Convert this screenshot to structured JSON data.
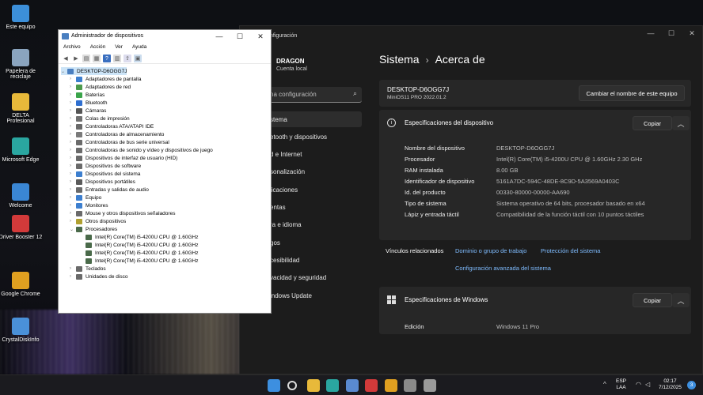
{
  "desktop": {
    "icons": [
      {
        "label": "Este equipo",
        "icon": "computer-icon",
        "color": "#3c8fd9"
      },
      {
        "label": "Papelera de reciclaje",
        "icon": "recycle-bin-icon",
        "color": "#8aa4bf"
      },
      {
        "label": "DELTA Profesional",
        "icon": "folder-icon",
        "color": "#e8b93a"
      },
      {
        "label": "Microsoft Edge",
        "icon": "edge-icon",
        "color": "#2aa6a0"
      },
      {
        "label": "Welcome",
        "icon": "welcome-icon",
        "color": "#3a86d4"
      },
      {
        "label": "Driver Booster 12",
        "icon": "driver-booster-icon",
        "color": "#d23a3a"
      },
      {
        "label": "Google Chrome",
        "icon": "chrome-icon",
        "color": "#e0a020"
      },
      {
        "label": "CrystalDiskInfo",
        "icon": "crystaldiskinfo-icon",
        "color": "#4a90d9"
      }
    ]
  },
  "settings": {
    "title": "Configuración",
    "title_visible": "nfiguración",
    "user": {
      "name": "DRAGON",
      "account": "Cuenta local"
    },
    "search": {
      "placeholder": "na configuración"
    },
    "nav": [
      {
        "label": "stema",
        "active": true
      },
      {
        "label": "etooth y dispositivos",
        "active": false
      },
      {
        "label": "d e Internet",
        "active": false
      },
      {
        "label": "sonalización",
        "active": false
      },
      {
        "label": "licaciones",
        "active": false
      },
      {
        "label": "entas",
        "active": false
      },
      {
        "label": "ra e idioma",
        "active": false
      },
      {
        "label": "gos",
        "active": false
      },
      {
        "label": "cesibilidad",
        "active": false
      },
      {
        "label": "vacidad y seguridad",
        "active": false
      },
      {
        "label": "indows Update",
        "active": false
      }
    ],
    "breadcrumb": {
      "parent": "Sistema",
      "separator": "›",
      "current": "Acerca de"
    },
    "device_card": {
      "name": "DESKTOP-D6OGG7J",
      "os": "MiniOS11 PRO 2022.01.2",
      "rename_button": "Cambiar el nombre de este equipo"
    },
    "device_specs": {
      "title": "Especificaciones del dispositivo",
      "copy_button": "Copiar",
      "rows": [
        {
          "label": "Nombre del dispositivo",
          "value": "DESKTOP-D6OGG7J"
        },
        {
          "label": "Procesador",
          "value": "Intel(R) Core(TM) i5-4200U CPU @ 1.60GHz   2.30 GHz"
        },
        {
          "label": "RAM instalada",
          "value": "8.00 GB"
        },
        {
          "label": "Identificador de dispositivo",
          "value": "5161A7DC-594C-48DE-8C9D-5A3569A0403C"
        },
        {
          "label": "Id. del producto",
          "value": "00330-80000-00000-AA690"
        },
        {
          "label": "Tipo de sistema",
          "value": "Sistema operativo de 64 bits, procesador basado en x64"
        },
        {
          "label": "Lápiz y entrada táctil",
          "value": "Compatibilidad de la función táctil con 10 puntos táctiles"
        }
      ]
    },
    "related": {
      "label": "Vínculos relacionados",
      "links": [
        "Dominio o grupo de trabajo",
        "Protección del sistema",
        "Configuración avanzada del sistema"
      ]
    },
    "windows_specs": {
      "title": "Especificaciones de Windows",
      "copy_button": "Copiar",
      "rows": [
        {
          "label": "Edición",
          "value": "Windows 11 Pro"
        }
      ]
    }
  },
  "device_manager": {
    "title": "Administrador de dispositivos",
    "menu": [
      "Archivo",
      "Acción",
      "Ver",
      "Ayuda"
    ],
    "root": "DESKTOP-D6OGG7J",
    "categories": [
      {
        "label": "Adaptadores de pantalla",
        "expanded": false,
        "color": "#3d7fcf"
      },
      {
        "label": "Adaptadores de red",
        "expanded": false,
        "color": "#4c9a4c"
      },
      {
        "label": "Baterías",
        "expanded": false,
        "color": "#3aa44a"
      },
      {
        "label": "Bluetooth",
        "expanded": false,
        "color": "#2f6fd0"
      },
      {
        "label": "Cámaras",
        "expanded": false,
        "color": "#555555"
      },
      {
        "label": "Colas de impresión",
        "expanded": false,
        "color": "#707070"
      },
      {
        "label": "Controladoras ATA/ATAPI IDE",
        "expanded": false,
        "color": "#6a6a6a"
      },
      {
        "label": "Controladoras de almacenamiento",
        "expanded": false,
        "color": "#7a7a7a"
      },
      {
        "label": "Controladoras de bus serie universal",
        "expanded": false,
        "color": "#6a6a6a"
      },
      {
        "label": "Controladoras de sonido y vídeo y dispositivos de juego",
        "expanded": false,
        "color": "#6a6a6a"
      },
      {
        "label": "Dispositivos de interfaz de usuario (HID)",
        "expanded": false,
        "color": "#6a6a6a"
      },
      {
        "label": "Dispositivos de software",
        "expanded": false,
        "color": "#6a6a6a"
      },
      {
        "label": "Dispositivos del sistema",
        "expanded": false,
        "color": "#3d7fcf"
      },
      {
        "label": "Dispositivos portátiles",
        "expanded": false,
        "color": "#5a5a5a"
      },
      {
        "label": "Entradas y salidas de audio",
        "expanded": false,
        "color": "#6a6a6a"
      },
      {
        "label": "Equipo",
        "expanded": false,
        "color": "#3d7fcf"
      },
      {
        "label": "Monitores",
        "expanded": false,
        "color": "#3d7fcf"
      },
      {
        "label": "Mouse y otros dispositivos señaladores",
        "expanded": false,
        "color": "#6a6a6a"
      },
      {
        "label": "Otros dispositivos",
        "expanded": false,
        "color": "#b0a030"
      },
      {
        "label": "Procesadores",
        "expanded": true,
        "color": "#4a6a4a",
        "children": [
          "Intel(R) Core(TM) i5-4200U CPU @ 1.60GHz",
          "Intel(R) Core(TM) i5-4200U CPU @ 1.60GHz",
          "Intel(R) Core(TM) i5-4200U CPU @ 1.60GHz",
          "Intel(R) Core(TM) i5-4200U CPU @ 1.60GHz"
        ]
      },
      {
        "label": "Teclados",
        "expanded": false,
        "color": "#6a6a6a"
      },
      {
        "label": "Unidades de disco",
        "expanded": false,
        "color": "#6a6a6a"
      }
    ]
  },
  "taskbar": {
    "apps": [
      {
        "icon": "start-icon",
        "color": "#3d8fe0"
      },
      {
        "icon": "search-icon",
        "color": "#dddddd"
      },
      {
        "icon": "file-explorer-icon",
        "color": "#e8b93a"
      },
      {
        "icon": "edge-icon",
        "color": "#2aa6a0"
      },
      {
        "icon": "store-icon",
        "color": "#5a8ad0"
      },
      {
        "icon": "driver-booster-icon",
        "color": "#d23a3a"
      },
      {
        "icon": "chrome-icon",
        "color": "#e0a020"
      },
      {
        "icon": "settings-icon",
        "color": "#8a8a8a"
      },
      {
        "icon": "device-manager-icon",
        "color": "#9a9a9a"
      }
    ],
    "language": {
      "top": "ESP",
      "bottom": "LAA"
    },
    "clock": {
      "time": "02:17",
      "date": "7/12/2025"
    },
    "notification_count": "3"
  }
}
